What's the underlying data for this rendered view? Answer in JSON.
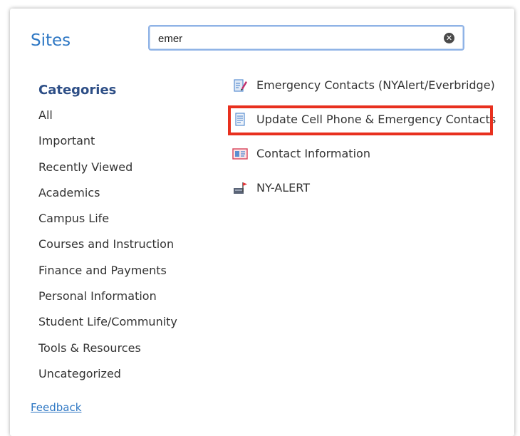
{
  "header": {
    "title": "Sites"
  },
  "search": {
    "value": "emer",
    "clear_icon": "clear-icon"
  },
  "categories": {
    "heading": "Categories",
    "items": [
      "All",
      "Important",
      "Recently Viewed",
      "Academics",
      "Campus Life",
      "Courses and Instruction",
      "Finance and Payments",
      "Personal Information",
      "Student Life/Community",
      "Tools & Resources",
      "Uncategorized"
    ]
  },
  "results": [
    {
      "label": "Emergency Contacts (NYAlert/Everbridge)",
      "icon": "edit-document-icon"
    },
    {
      "label": "Update Cell Phone & Emergency Contacts",
      "icon": "form-document-icon",
      "highlighted": true
    },
    {
      "label": "Contact Information",
      "icon": "id-card-icon"
    },
    {
      "label": "NY-ALERT",
      "icon": "alert-flag-icon"
    }
  ],
  "footer": {
    "feedback_label": "Feedback"
  },
  "colors": {
    "accent": "#2f78c4",
    "heading": "#2d4e86",
    "highlight": "#e8301e"
  }
}
